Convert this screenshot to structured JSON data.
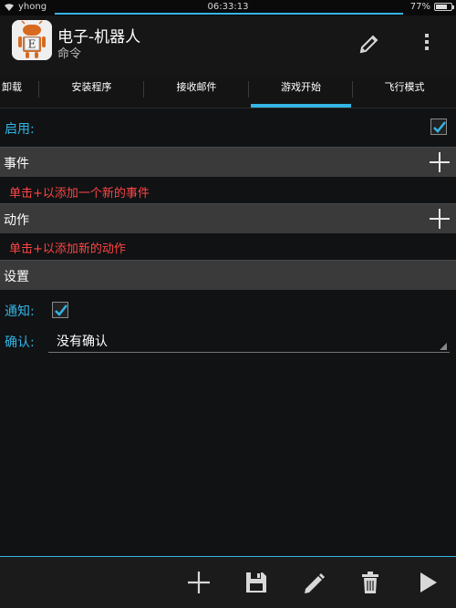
{
  "statusbar": {
    "carrier": "yhong",
    "time": "06:33:13",
    "battery": "77%",
    "battery_level": 0.77
  },
  "actionbar": {
    "title": "电子-机器人",
    "subtitle": "命令",
    "icon_letter": "E"
  },
  "tabs": [
    {
      "label": "卸载"
    },
    {
      "label": "安装程序"
    },
    {
      "label": "接收邮件"
    },
    {
      "label": "游戏开始",
      "selected": true
    },
    {
      "label": "飞行模式"
    }
  ],
  "enable": {
    "label": "启用:",
    "checked": true
  },
  "events": {
    "title": "事件",
    "hint": "单击+以添加一个新的事件"
  },
  "actions": {
    "title": "动作",
    "hint": "单击+以添加新的动作"
  },
  "settings": {
    "title": "设置",
    "notify_label": "通知:",
    "notify_checked": true,
    "confirm_label": "确认:",
    "confirm_value": "没有确认"
  },
  "colors": {
    "accent": "#33b5e5",
    "hint": "#ff4444",
    "section_bg": "#3a3a3a"
  },
  "icons": {
    "actionbar": [
      "edit-icon",
      "overflow-menu-icon"
    ],
    "bottombar": [
      "add-icon",
      "save-icon",
      "edit-icon",
      "delete-icon",
      "play-icon"
    ]
  }
}
